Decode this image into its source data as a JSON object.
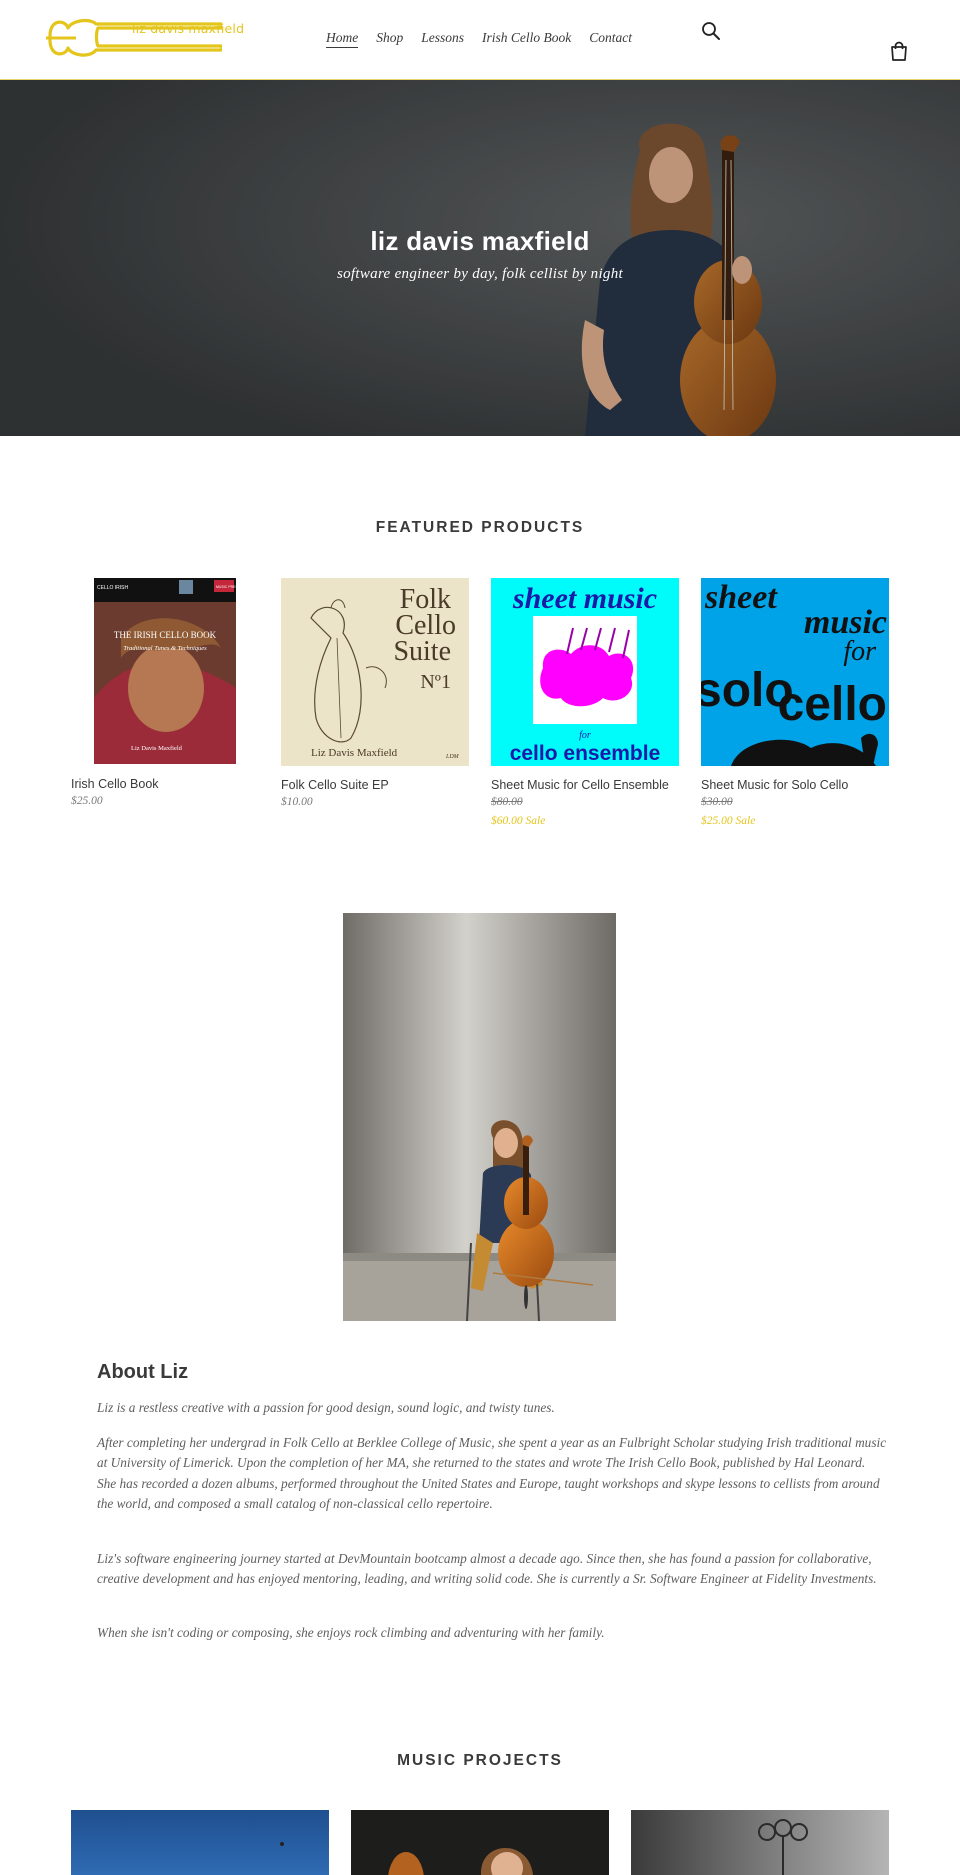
{
  "header": {
    "logo_text": "liz davis maxfield",
    "nav": [
      {
        "label": "Home",
        "active": true
      },
      {
        "label": "Shop",
        "active": false
      },
      {
        "label": "Lessons",
        "active": false
      },
      {
        "label": "Irish Cello Book",
        "active": false
      },
      {
        "label": "Contact",
        "active": false
      }
    ],
    "icons": {
      "search": "search-icon",
      "cart": "shopping-bag-icon"
    }
  },
  "hero": {
    "title": "liz davis maxfield",
    "subtitle": "software engineer by day, folk cellist by night"
  },
  "featured": {
    "heading": "FEATURED PRODUCTS",
    "products": [
      {
        "title": "Irish Cello Book",
        "price": "$25.00",
        "cover": {
          "series": "CELLO IRISH",
          "publisher": "MUSIC PRESS",
          "book_title": "THE IRISH CELLO BOOK",
          "book_sub": "Traditional Tunes & Techniques",
          "author": "Liz Davis Maxfield"
        }
      },
      {
        "title": "Folk Cello Suite EP",
        "price": "$10.00",
        "cover": {
          "line1": "Folk",
          "line2": "Cello",
          "line3": "Suite",
          "number": "Nº1",
          "artist": "Liz Davis Maxfield",
          "signature": "LDM"
        }
      },
      {
        "title": "Sheet Music for Cello Ensemble",
        "old_price": "$80.00",
        "sale_price": "$60.00 Sale",
        "cover": {
          "top": "sheet music",
          "small": "for",
          "bottom": "cello ensemble"
        }
      },
      {
        "title": "Sheet Music for Solo Cello",
        "old_price": "$30.00",
        "sale_price": "$25.00 Sale",
        "cover": {
          "line1": "sheet",
          "line2": "music",
          "line3": "for",
          "line4": "solo",
          "line5": "cello"
        }
      }
    ]
  },
  "about": {
    "title": "About Liz",
    "paragraphs": [
      "Liz is a restless creative with a passion for good design, sound logic, and twisty tunes.",
      "After completing her undergrad in Folk Cello at Berklee College of Music, she spent a year as an Fulbright Scholar studying Irish traditional music at University of Limerick. Upon the completion of her MA, she returned to the states and wrote The Irish Cello Book, published by Hal Leonard. She has recorded a dozen albums, performed throughout the United States and Europe, taught workshops and skype lessons to cellists from around the world, and composed a small catalog of non-classical cello repertoire.",
      "Liz's software engineering journey started at DevMountain bootcamp almost a decade ago. Since then, she has found a passion for collaborative, creative development and has enjoyed mentoring, leading, and writing solid code. She is currently a Sr. Software Engineer at Fidelity Investments.",
      "When she isn't coding or composing, she enjoys rock climbing and adventuring with her family."
    ]
  },
  "projects": {
    "heading": "MUSIC PROJECTS"
  },
  "colors": {
    "accent": "#e4c51c",
    "text": "#3a3a3a",
    "muted": "#7a7a7a",
    "hero_bg": "#4b4f50"
  }
}
